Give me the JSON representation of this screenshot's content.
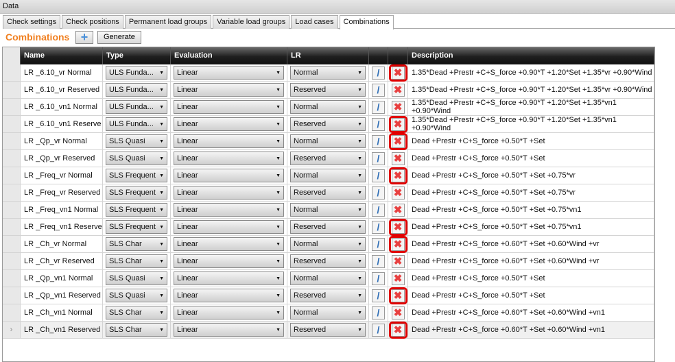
{
  "window_title": "Data",
  "tabs": [
    "Check settings",
    "Check positions",
    "Permanent load groups",
    "Variable load groups",
    "Load cases",
    "Combinations"
  ],
  "active_tab": 5,
  "section_title": "Combinations",
  "generate_label": "Generate",
  "columns": [
    "",
    "Name",
    "Type",
    "Evaluation",
    "LR",
    "",
    "",
    "Description"
  ],
  "highlight_color": "#e00000",
  "rows": [
    {
      "name": "LR _6.10_vr Normal",
      "type": "ULS Funda...",
      "eval": "Linear",
      "lr": "Normal",
      "desc": "1.35*Dead +Prestr +C+S_force +0.90*T +1.20*Set +1.35*vr +0.90*Wind",
      "hl": true
    },
    {
      "name": "LR _6.10_vr Reserved",
      "type": "ULS Funda...",
      "eval": "Linear",
      "lr": "Reserved",
      "desc": "1.35*Dead +Prestr +C+S_force +0.90*T +1.20*Set +1.35*vr +0.90*Wind",
      "hl": false
    },
    {
      "name": "LR _6.10_vn1 Normal",
      "type": "ULS Funda...",
      "eval": "Linear",
      "lr": "Normal",
      "desc": "1.35*Dead +Prestr +C+S_force +0.90*T +1.20*Set +1.35*vn1 +0.90*Wind",
      "hl": false
    },
    {
      "name": "LR _6.10_vn1 Reserve",
      "type": "ULS Funda...",
      "eval": "Linear",
      "lr": "Reserved",
      "desc": "1.35*Dead +Prestr +C+S_force +0.90*T +1.20*Set +1.35*vn1 +0.90*Wind",
      "hl": true
    },
    {
      "name": "LR _Qp_vr Normal",
      "type": "SLS Quasi",
      "eval": "Linear",
      "lr": "Normal",
      "desc": "Dead +Prestr +C+S_force +0.50*T +Set",
      "hl": true
    },
    {
      "name": "LR _Qp_vr Reserved",
      "type": "SLS Quasi",
      "eval": "Linear",
      "lr": "Reserved",
      "desc": "Dead +Prestr +C+S_force +0.50*T +Set",
      "hl": false
    },
    {
      "name": "LR _Freq_vr Normal",
      "type": "SLS Frequent",
      "eval": "Linear",
      "lr": "Normal",
      "desc": "Dead +Prestr +C+S_force +0.50*T +Set +0.75*vr",
      "hl": true
    },
    {
      "name": "LR _Freq_vr Reserved",
      "type": "SLS Frequent",
      "eval": "Linear",
      "lr": "Reserved",
      "desc": "Dead +Prestr +C+S_force +0.50*T +Set +0.75*vr",
      "hl": false
    },
    {
      "name": "LR _Freq_vn1 Normal",
      "type": "SLS Frequent",
      "eval": "Linear",
      "lr": "Normal",
      "desc": "Dead +Prestr +C+S_force +0.50*T +Set +0.75*vn1",
      "hl": false
    },
    {
      "name": "LR _Freq_vn1 Reserve",
      "type": "SLS Frequent",
      "eval": "Linear",
      "lr": "Reserved",
      "desc": "Dead +Prestr +C+S_force +0.50*T +Set +0.75*vn1",
      "hl": true
    },
    {
      "name": "LR _Ch_vr Normal",
      "type": "SLS Char",
      "eval": "Linear",
      "lr": "Normal",
      "desc": "Dead +Prestr +C+S_force +0.60*T +Set +0.60*Wind +vr",
      "hl": true
    },
    {
      "name": "LR _Ch_vr Reserved",
      "type": "SLS Char",
      "eval": "Linear",
      "lr": "Reserved",
      "desc": "Dead +Prestr +C+S_force +0.60*T +Set +0.60*Wind +vr",
      "hl": false
    },
    {
      "name": "LR _Qp_vn1 Normal",
      "type": "SLS Quasi",
      "eval": "Linear",
      "lr": "Normal",
      "desc": "Dead +Prestr +C+S_force +0.50*T +Set",
      "hl": false
    },
    {
      "name": "LR _Qp_vn1 Reserved",
      "type": "SLS Quasi",
      "eval": "Linear",
      "lr": "Reserved",
      "desc": "Dead +Prestr +C+S_force +0.50*T +Set",
      "hl": true
    },
    {
      "name": "LR _Ch_vn1 Normal",
      "type": "SLS Char",
      "eval": "Linear",
      "lr": "Normal",
      "desc": "Dead +Prestr +C+S_force +0.60*T +Set +0.60*Wind +vn1",
      "hl": false
    },
    {
      "name": "LR _Ch_vn1 Reserved",
      "type": "SLS Char",
      "eval": "Linear",
      "lr": "Reserved",
      "desc": "Dead +Prestr +C+S_force +0.60*T +Set +0.60*Wind +vn1",
      "hl": true,
      "current": true
    }
  ]
}
